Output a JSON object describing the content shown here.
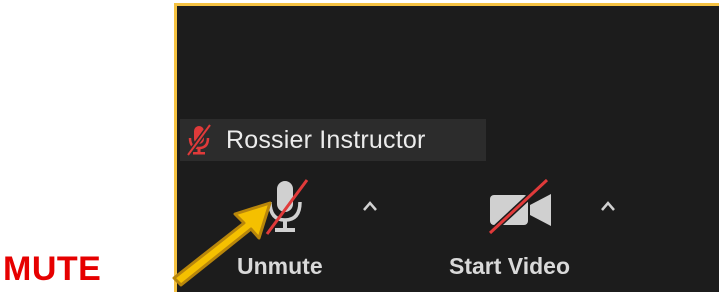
{
  "participant": {
    "name": "Rossier Instructor",
    "muted_icon": "muted-microphone-icon"
  },
  "toolbar": {
    "unmute_label": "Unmute",
    "start_video_label": "Start Video",
    "mic_icon": "microphone-off-icon",
    "video_icon": "video-off-icon",
    "caret_icon": "caret-up-icon"
  },
  "annotation": {
    "label": "MUTE",
    "arrow_icon": "pointer-arrow-icon",
    "label_color": "#e60000",
    "arrow_color": "#f5c000",
    "highlight_border_color": "#f5c242"
  },
  "colors": {
    "panel_background": "#1c1c1c",
    "name_tag_background": "#2c2c2c",
    "slash_color": "#e03a3a",
    "icon_color": "#d0d0d0"
  }
}
